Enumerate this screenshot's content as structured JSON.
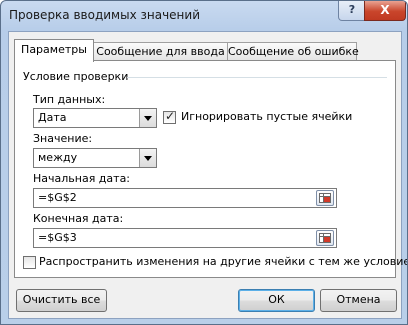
{
  "window": {
    "title": "Проверка вводимых значений"
  },
  "title_buttons": {
    "help": "?",
    "close": "X"
  },
  "tabs": [
    {
      "label": "Параметры",
      "active": true
    },
    {
      "label": "Сообщение для ввода",
      "active": false
    },
    {
      "label": "Сообщение об ошибке",
      "active": false
    }
  ],
  "group": {
    "title": "Условие проверки"
  },
  "data_type": {
    "label": "Тип данных:",
    "value": "Дата"
  },
  "ignore_blank": {
    "label": "Игнорировать пустые ячейки",
    "checked": true,
    "mark": "✓"
  },
  "condition": {
    "label": "Значение:",
    "value": "между"
  },
  "start_date": {
    "label": "Начальная дата:",
    "value": "=$G$2"
  },
  "end_date": {
    "label": "Конечная дата:",
    "value": "=$G$3"
  },
  "apply_all": {
    "label": "Распространить изменения на другие ячейки с тем же условием",
    "checked": false
  },
  "buttons": {
    "clear": "Очистить все",
    "ok": "ОК",
    "cancel": "Отмена"
  },
  "colors": {
    "title_bar": "#b9cfe9",
    "client_bg": "#f0f0f0",
    "close_button": "#c9452b"
  }
}
